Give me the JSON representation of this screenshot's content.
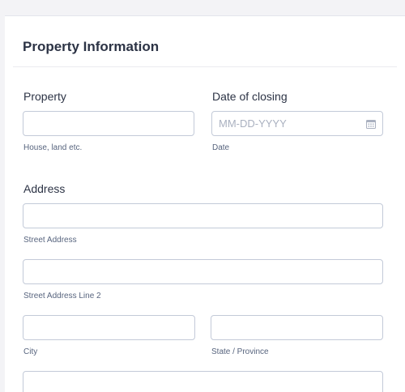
{
  "section": {
    "title": "Property Information"
  },
  "property": {
    "label": "Property",
    "value": "",
    "sublabel": "House, land etc."
  },
  "closing": {
    "label": "Date of closing",
    "placeholder": "MM-DD-YYYY",
    "sublabel": "Date",
    "icon": "calendar-icon"
  },
  "address": {
    "label": "Address",
    "street": {
      "value": "",
      "sublabel": "Street Address"
    },
    "street2": {
      "value": "",
      "sublabel": "Street Address Line 2"
    },
    "city": {
      "value": "",
      "sublabel": "City"
    },
    "state": {
      "value": "",
      "sublabel": "State / Province"
    },
    "postal": {
      "value": ""
    }
  },
  "colors": {
    "background": "#f3f3f6",
    "card": "#ffffff",
    "text": "#2c3345",
    "sublabel": "#57647e",
    "border": "#c3cad8",
    "placeholder": "#aab1c0"
  }
}
